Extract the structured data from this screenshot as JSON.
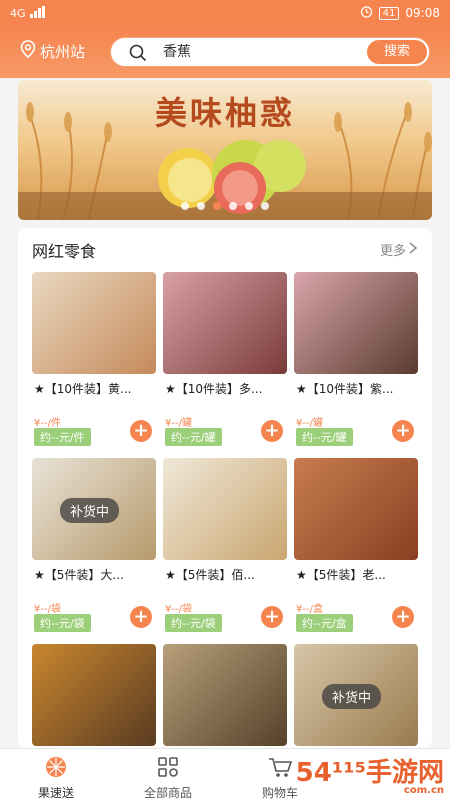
{
  "status": {
    "signal": "4G",
    "battery": "41",
    "time": "09:08"
  },
  "header": {
    "city": "杭州站",
    "search_value": "香蕉",
    "search_button": "搜索"
  },
  "banner": {
    "title": "美味柚惑",
    "dots": 6,
    "active_dot": 3
  },
  "section": {
    "title": "网红零食",
    "more": "更多"
  },
  "products": [
    {
      "name": "★【10件装】黄...",
      "price": "¥--/件",
      "unit": "约--元/件",
      "colors": [
        "#e9d7c0",
        "#c48a5a"
      ],
      "out": ""
    },
    {
      "name": "★【10件装】多...",
      "price": "¥--/罐",
      "unit": "约--元/罐",
      "colors": [
        "#d8a1a6",
        "#7a3b3a"
      ],
      "out": ""
    },
    {
      "name": "★【10件装】紫...",
      "price": "¥--/罐",
      "unit": "约--元/罐",
      "colors": [
        "#d9a5ab",
        "#5a3b2e"
      ],
      "out": ""
    },
    {
      "name": "★【5件装】大...",
      "price": "¥--/袋",
      "unit": "约--元/袋",
      "colors": [
        "#e8e2d6",
        "#b79b6d"
      ],
      "out": "补货中"
    },
    {
      "name": "★【5件装】佰...",
      "price": "¥--/袋",
      "unit": "约--元/袋",
      "colors": [
        "#efe8d8",
        "#caa670"
      ],
      "out": ""
    },
    {
      "name": "★【5件装】老...",
      "price": "¥--/盒",
      "unit": "约--元/盒",
      "colors": [
        "#c77d4e",
        "#8a3f22"
      ],
      "out": ""
    },
    {
      "name": "",
      "price": "",
      "unit": "",
      "colors": [
        "#c9872e",
        "#5a3b22"
      ],
      "out": ""
    },
    {
      "name": "",
      "price": "",
      "unit": "",
      "colors": [
        "#b8a07a",
        "#56412a"
      ],
      "out": ""
    },
    {
      "name": "",
      "price": "",
      "unit": "",
      "colors": [
        "#d7c7a8",
        "#9a7b50"
      ],
      "out": "补货中"
    }
  ],
  "tabs": [
    {
      "label": "果速送",
      "icon": "orange-slice-icon"
    },
    {
      "label": "全部商品",
      "icon": "grid-icon"
    },
    {
      "label": "购物车",
      "icon": "cart-icon"
    }
  ],
  "watermark": {
    "text": "54¹¹⁵手游网",
    "sub": "com.cn"
  },
  "theme": {
    "accent": "#f6844f",
    "green": "#9ccf7a"
  }
}
